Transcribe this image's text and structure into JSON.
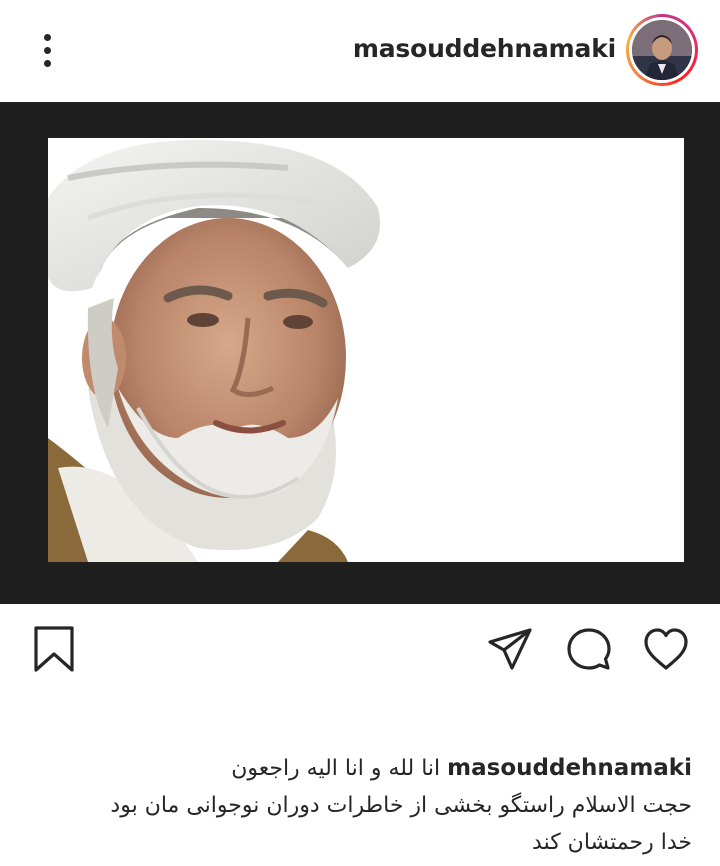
{
  "header": {
    "username": "masouddehnamaki",
    "avatar_icon": "profile-avatar",
    "more_icon": "more-vertical-icon"
  },
  "post": {
    "image_icon": "cleric-portrait-photo"
  },
  "actions": {
    "like_icon": "heart-icon",
    "comment_icon": "comment-icon",
    "share_icon": "send-icon",
    "save_icon": "bookmark-icon"
  },
  "caption": {
    "username": "masouddehnamaki",
    "line1": "انا لله و انا الیه راجعون",
    "line2": "حجت الاسلام راستگو بخشی از خاطرات دوران نوجوانی مان بود",
    "line3": "خدا رحمتشان کند"
  },
  "colors": {
    "text": "#262626",
    "post_border": "#1f1f1f",
    "story_ring_start": "#c13584",
    "story_ring_end": "#fcaf45"
  }
}
